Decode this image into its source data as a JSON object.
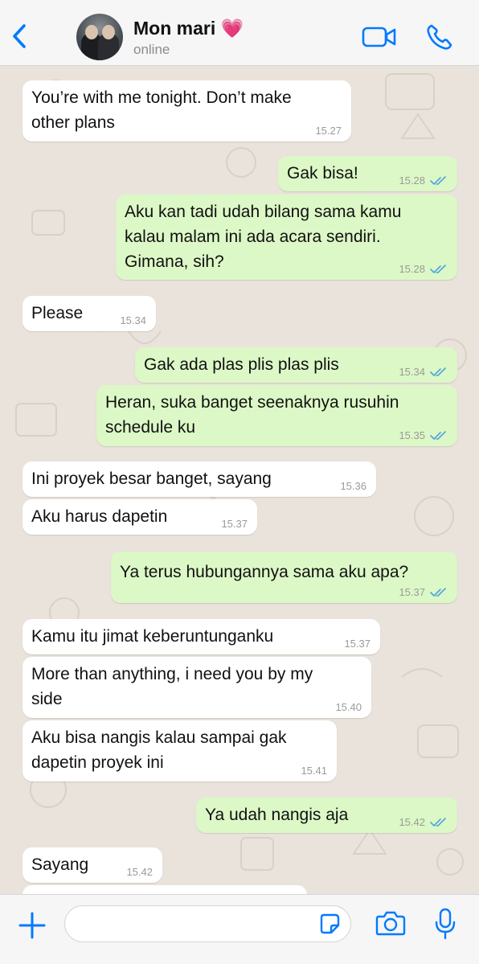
{
  "header": {
    "contact_name": "Mon mari 💗",
    "status": "online"
  },
  "messages": [
    {
      "dir": "in",
      "text": "You’re with me tonight. Don’t make\nother plans",
      "time": "15.27"
    },
    {
      "dir": "out",
      "text": "Gak bisa!",
      "time": "15.28",
      "read": true
    },
    {
      "dir": "out",
      "text": "Aku kan tadi udah bilang sama kamu\nkalau malam ini ada acara sendiri.\nGimana, sih?",
      "time": "15.28",
      "read": true
    },
    {
      "dir": "in",
      "text": "Please",
      "time": "15.34"
    },
    {
      "dir": "out",
      "text": "Gak ada plas plis plas plis",
      "time": "15.34",
      "read": true
    },
    {
      "dir": "out",
      "text": "Heran, suka banget seenaknya rusuhin\nschedule ku",
      "time": "15.35",
      "read": true
    },
    {
      "dir": "in",
      "text": "Ini proyek besar banget, sayang",
      "time": "15.36"
    },
    {
      "dir": "in",
      "text": "Aku harus dapetin",
      "time": "15.37"
    },
    {
      "dir": "out",
      "text": "Ya terus hubungannya sama aku apa?",
      "time": "15.37",
      "read": true
    },
    {
      "dir": "in",
      "text": "Kamu itu jimat keberuntunganku",
      "time": "15.37"
    },
    {
      "dir": "in",
      "text": "More than anything, i need you by my\nside",
      "time": "15.40"
    },
    {
      "dir": "in",
      "text": "Aku bisa nangis kalau sampai gak\ndapetin proyek ini",
      "time": "15.41"
    },
    {
      "dir": "out",
      "text": "Ya udah nangis aja",
      "time": "15.42",
      "read": true
    },
    {
      "dir": "in",
      "text": "Sayang",
      "time": "15.42"
    },
    {
      "dir": "in",
      "text": "",
      "time": ""
    }
  ],
  "input": {
    "value": "",
    "placeholder": ""
  },
  "colors": {
    "accent": "#007aff",
    "outgoing_bubble": "#dcf8c6",
    "incoming_bubble": "#ffffff",
    "chat_background": "#e9e3db",
    "read_ticks": "#4fa3e0"
  },
  "icons": {
    "back": "chevron-left-icon",
    "video": "video-camera-icon",
    "call": "phone-icon",
    "attach": "plus-icon",
    "sticker": "sticker-icon",
    "camera": "camera-icon",
    "mic": "microphone-icon"
  }
}
